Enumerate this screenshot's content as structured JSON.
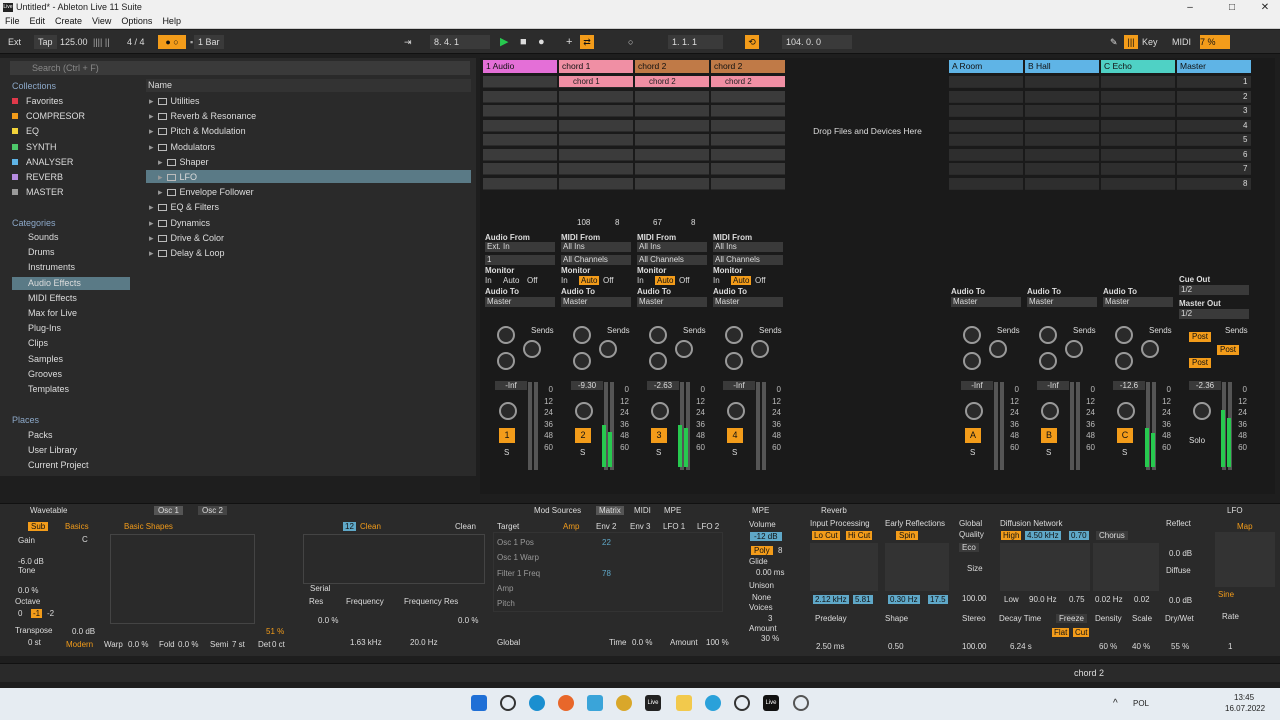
{
  "window": {
    "title": "Untitled* - Ableton Live 11 Suite",
    "app_icon": "Live"
  },
  "menu": [
    "File",
    "Edit",
    "Create",
    "View",
    "Options",
    "Help"
  ],
  "transport": {
    "ext": "Ext",
    "tap": "Tap",
    "bpm": "125.00",
    "signature": "4 / 4",
    "quant": "1 Bar",
    "arr_pos": "8.   4.   1",
    "loop_start": "1.   1.   1",
    "loop_len": "104.   0.   0",
    "key": "Key",
    "midi": "MIDI",
    "cpu": "7 %"
  },
  "browser": {
    "search_placeholder": "Search (Ctrl + F)",
    "collections_title": "Collections",
    "collections": [
      {
        "label": "Favorites",
        "color": "#e0394a"
      },
      {
        "label": "COMPRESOR",
        "color": "#f39c1a"
      },
      {
        "label": "EQ",
        "color": "#f2d33a"
      },
      {
        "label": "SYNTH",
        "color": "#4ec96b"
      },
      {
        "label": "ANALYSER",
        "color": "#5fb4e6"
      },
      {
        "label": "REVERB",
        "color": "#b58be0"
      },
      {
        "label": "MASTER",
        "color": "#9a9a9a"
      }
    ],
    "categories_title": "Categories",
    "categories": [
      "Sounds",
      "Drums",
      "Instruments",
      "Audio Effects",
      "MIDI Effects",
      "Max for Live",
      "Plug-Ins",
      "Clips",
      "Samples",
      "Grooves",
      "Templates"
    ],
    "places_title": "Places",
    "places": [
      "Packs",
      "User Library",
      "Current Project"
    ],
    "name_header": "Name",
    "tree": [
      "Utilities",
      "Reverb & Resonance",
      "Pitch & Modulation",
      "Modulators",
      "Shaper",
      "LFO",
      "Envelope Follower",
      "EQ & Filters",
      "Dynamics",
      "Drive & Color",
      "Delay & Loop"
    ]
  },
  "session": {
    "tracks": [
      {
        "name": "1 Audio",
        "color": "#e46fd7"
      },
      {
        "name": "chord 1",
        "color": "#f08fa4"
      },
      {
        "name": "chord 2",
        "color": "#c07a47"
      },
      {
        "name": "chord 2",
        "color": "#c07a47"
      }
    ],
    "returns": [
      {
        "name": "A Room",
        "color": "#5fb4e6"
      },
      {
        "name": "B Hall",
        "color": "#5fb4e6"
      },
      {
        "name": "C Echo",
        "color": "#4fd1c5"
      },
      {
        "name": "Master",
        "color": "#5fb4e6"
      }
    ],
    "clips": [
      "chord 1",
      "chord 2",
      "chord 2"
    ],
    "drop_text": "Drop Files and Devices Here",
    "scene_nums": [
      "1",
      "2",
      "3",
      "4",
      "5",
      "6",
      "7",
      "8"
    ],
    "clip_stop_vals": [
      "108",
      "8",
      "67",
      "8"
    ],
    "audio_from": "Audio From",
    "midi_from": "MIDI From",
    "ext_in": "Ext. In",
    "all_ins": "All Ins",
    "all_channels": "All Channels",
    "one": "1",
    "monitor": "Monitor",
    "mon_in": "In",
    "mon_auto": "Auto",
    "mon_off": "Off",
    "audio_to": "Audio To",
    "master": "Master",
    "cue_out": "Cue Out",
    "cue_val": "1/2",
    "master_out": "Master Out",
    "master_val": "1/2",
    "sends": "Sends",
    "post": "Post",
    "vols": [
      "-Inf",
      "-9.30",
      "-2.63",
      "-Inf",
      "-Inf",
      "-Inf",
      "-12.6",
      "-2.36"
    ],
    "scale": [
      "0",
      "12",
      "24",
      "36",
      "48",
      "60"
    ],
    "tnums": [
      "1",
      "2",
      "3",
      "4",
      "A",
      "B",
      "C"
    ],
    "solo": "S",
    "solo_text": "Solo"
  },
  "wavetable": {
    "title": "Wavetable",
    "osc1": "Osc 1",
    "osc2": "Osc 2",
    "sub": "Sub",
    "basics": "Basics",
    "shapes": "Basic Shapes",
    "gain": "Gain",
    "gain_val": "-6.0 dB",
    "tone": "Tone",
    "tone_val": "0.0 %",
    "octave": "Octave",
    "oct_vals": [
      "0",
      "-1",
      "-2"
    ],
    "transpose": "Transpose",
    "transpose_val": "0 st",
    "level": "0.0 dB",
    "c": "C",
    "modern": "Modern",
    "warp": "Warp",
    "warp_val": "0.0 %",
    "fold": "Fold",
    "fold_val": "0.0 %",
    "semi": "Semi",
    "semi_val": "7 st",
    "det": "Det",
    "det_val": "0 ct",
    "pct": "51 %",
    "filter1": "12",
    "clean": "Clean",
    "serial": "Serial",
    "res": "Res",
    "res_val": "0.0 %",
    "freq": "Frequency",
    "freq_val": "1.63 kHz",
    "freqres": "Frequency Res",
    "fr_val": "20.0 Hz",
    "fr2": "0.0 %",
    "tabs": [
      "Mod Sources",
      "Matrix",
      "MIDI",
      "MPE"
    ],
    "target": "Target",
    "mod_cols": [
      "Amp",
      "Env 2",
      "Env 3",
      "LFO 1",
      "LFO 2"
    ],
    "mod_rows": [
      "Osc 1 Pos",
      "Osc 1 Warp",
      "Filter 1 Freq",
      "Amp",
      "Pitch"
    ],
    "cell1": "22",
    "cell2": "78",
    "global": "Global",
    "time": "Time",
    "time_val": "0.0 %",
    "amount": "Amount",
    "amount_val": "100 %",
    "mpe": "MPE",
    "volume": "Volume",
    "vol_val": "-12 dB",
    "poly": "Poly",
    "poly_n": "8",
    "glide": "Glide",
    "glide_val": "0.00 ms",
    "unison": "Unison",
    "none": "None",
    "voices": "Voices",
    "voices_val": "3",
    "amt": "Amount",
    "amt_val": "30 %"
  },
  "reverb": {
    "title": "Reverb",
    "input": "Input Processing",
    "lo": "Lo Cut",
    "hi": "Hi Cut",
    "early": "Early Reflections",
    "spin": "Spin",
    "global": "Global",
    "quality": "Quality",
    "eco": "Eco",
    "size": "Size",
    "size_val": "100.00",
    "diff": "Diffusion Network",
    "high": "High",
    "high_val": "4.50 kHz",
    "hv2": "0.70",
    "chorus": "Chorus",
    "reflect": "Reflect",
    "reflect_val": "0.0 dB",
    "diffuse": "Diffuse",
    "diffuse_val": "0.0 dB",
    "v1": "2.12 kHz",
    "v2": "5.81",
    "v3": "0.30 Hz",
    "v4": "17.5",
    "low": "Low",
    "low_val": "90.0 Hz",
    "lv2": "0.75",
    "c1": "0.02 Hz",
    "c2": "0.02",
    "predelay": "Predelay",
    "pd_val": "2.50 ms",
    "shape": "Shape",
    "shape_val": "0.50",
    "stereo": "Stereo",
    "st_val": "100.00",
    "decay": "Decay Time",
    "decay_val": "6.24 s",
    "freeze": "Freeze",
    "flat": "Flat",
    "cut": "Cut",
    "density": "Density",
    "dens_val": "60 %",
    "scale": "Scale",
    "scale_val": "40 %",
    "drywet": "Dry/Wet",
    "dw_val": "55 %"
  },
  "lfo": {
    "title": "LFO",
    "map": "Map",
    "sine": "Sine",
    "rate": "Rate",
    "rate_val": "1"
  },
  "status": {
    "track": "chord 2"
  },
  "taskbar": {
    "lang": "POL",
    "time": "13:45",
    "date": "16.07.2022"
  }
}
